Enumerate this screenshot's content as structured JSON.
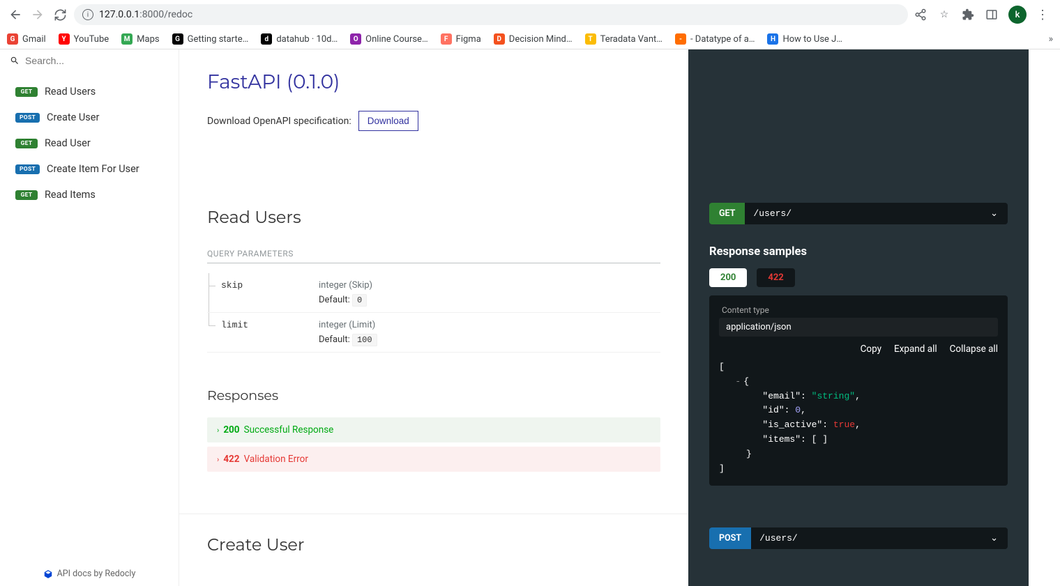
{
  "browser": {
    "url_host": "127.0.0.1",
    "url_path": ":8000/redoc",
    "avatar_letter": "k",
    "bookmarks": [
      {
        "label": "Gmail",
        "color": "#ea4335"
      },
      {
        "label": "YouTube",
        "color": "#ff0000"
      },
      {
        "label": "Maps",
        "color": "#34a853"
      },
      {
        "label": "Getting starte…",
        "color": "#000"
      },
      {
        "label": "datahub · 10d…",
        "color": "#000"
      },
      {
        "label": "Online Course…",
        "color": "#8e24aa"
      },
      {
        "label": "Figma",
        "color": "#ff7262"
      },
      {
        "label": "Decision Mind…",
        "color": "#f4511e"
      },
      {
        "label": "Teradata Vant…",
        "color": "#fbbc04"
      },
      {
        "label": "- Datatype of a…",
        "color": "#ff6d00"
      },
      {
        "label": "How to Use J…",
        "color": "#1a73e8"
      }
    ]
  },
  "sidebar": {
    "search_placeholder": "Search...",
    "items": [
      {
        "method": "GET",
        "label": "Read Users"
      },
      {
        "method": "POST",
        "label": "Create User"
      },
      {
        "method": "GET",
        "label": "Read User"
      },
      {
        "method": "POST",
        "label": "Create Item For User"
      },
      {
        "method": "GET",
        "label": "Read Items"
      }
    ],
    "footer": "API docs by Redocly"
  },
  "content": {
    "title": "FastAPI (0.1.0)",
    "download_label": "Download OpenAPI specification:",
    "download_btn": "Download",
    "section1_title": "Read Users",
    "params_label": "QUERY PARAMETERS",
    "params": [
      {
        "name": "skip",
        "type": "integer (Skip)",
        "default_label": "Default:",
        "default": "0"
      },
      {
        "name": "limit",
        "type": "integer (Limit)",
        "default_label": "Default:",
        "default": "100"
      }
    ],
    "responses_title": "Responses",
    "responses": [
      {
        "code": "200",
        "text": "Successful Response",
        "kind": "ok"
      },
      {
        "code": "422",
        "text": "Validation Error",
        "kind": "err"
      }
    ],
    "section2_title": "Create User"
  },
  "right": {
    "endpoint1": {
      "method": "GET",
      "path": "/users/"
    },
    "samples_title": "Response samples",
    "tabs": [
      {
        "label": "200",
        "kind": "ok"
      },
      {
        "label": "422",
        "kind": "err"
      }
    ],
    "content_type_label": "Content type",
    "content_type": "application/json",
    "actions": {
      "copy": "Copy",
      "expand": "Expand all",
      "collapse": "Collapse all"
    },
    "json": {
      "email_key": "\"email\"",
      "email_val": "\"string\"",
      "id_key": "\"id\"",
      "id_val": "0",
      "active_key": "\"is_active\"",
      "active_val": "true",
      "items_key": "\"items\"",
      "items_val": "[ ]"
    },
    "endpoint2": {
      "method": "POST",
      "path": "/users/"
    }
  }
}
